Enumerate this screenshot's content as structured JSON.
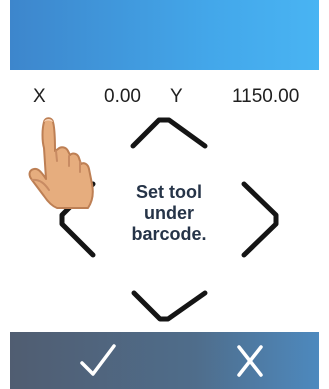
{
  "coordinates": {
    "x_label": "X",
    "x_value": "0.00",
    "y_label": "Y",
    "y_value": "1150.00"
  },
  "instruction": {
    "lines": [
      "Set tool",
      "under",
      "barcode."
    ]
  },
  "icons": {
    "jog_up": "chevron-up-icon",
    "jog_left": "chevron-left-icon",
    "jog_right": "chevron-right-icon",
    "jog_down": "chevron-down-icon",
    "touch_hint": "hand-pointer-icon",
    "confirm": "check-icon",
    "cancel": "x-icon"
  },
  "colors": {
    "header_start": "#3d86cc",
    "header_end": "#49b4f3",
    "footer_start": "#505d71",
    "footer_end": "#4d89be",
    "text": "#202020",
    "instruction_text": "#263448"
  }
}
